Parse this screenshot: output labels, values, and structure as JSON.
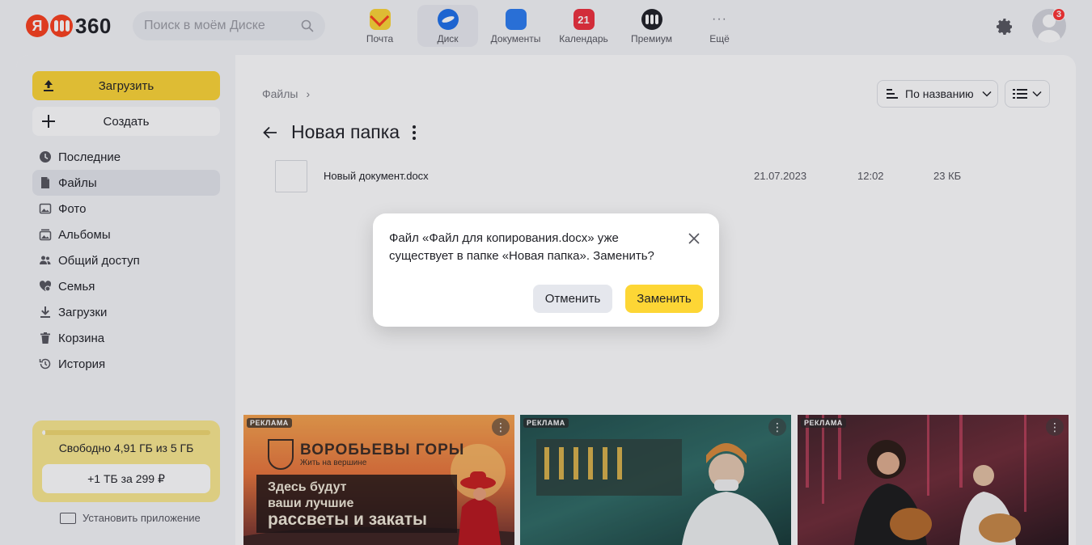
{
  "header": {
    "logo_text": "360",
    "search_placeholder": "Поиск в моём Диске",
    "apps": [
      {
        "label": "Почта",
        "icon": "mail-icon"
      },
      {
        "label": "Диск",
        "icon": "disk-icon",
        "active": true
      },
      {
        "label": "Документы",
        "icon": "documents-icon"
      },
      {
        "label": "Календарь",
        "icon": "calendar-icon",
        "badge": "21"
      },
      {
        "label": "Премиум",
        "icon": "premium-icon"
      },
      {
        "label": "Ещё",
        "icon": "more-icon"
      }
    ],
    "notifications_count": "3"
  },
  "sidebar": {
    "upload_label": "Загрузить",
    "create_label": "Создать",
    "items": [
      {
        "label": "Последние",
        "icon": "clock-icon"
      },
      {
        "label": "Файлы",
        "icon": "file-icon",
        "active": true
      },
      {
        "label": "Фото",
        "icon": "photo-icon"
      },
      {
        "label": "Альбомы",
        "icon": "album-icon"
      },
      {
        "label": "Общий доступ",
        "icon": "shared-icon"
      },
      {
        "label": "Семья",
        "icon": "family-icon"
      },
      {
        "label": "Загрузки",
        "icon": "download-icon"
      },
      {
        "label": "Корзина",
        "icon": "trash-icon"
      },
      {
        "label": "История",
        "icon": "history-icon"
      }
    ],
    "storage": {
      "used_fraction": 0.02,
      "free_text": "Свободно 4,91 ГБ из 5 ГБ",
      "buy_label": "+1 ТБ за 299 ₽"
    },
    "install_label": "Установить приложение"
  },
  "main": {
    "breadcrumb": "Файлы",
    "breadcrumb_sep": "›",
    "sort_label": "По названию",
    "folder_title": "Новая папка",
    "files": [
      {
        "name": "Новый документ.docx",
        "date": "21.07.2023",
        "time": "12:02",
        "size": "23 КБ"
      }
    ]
  },
  "ads": [
    {
      "tag": "РЕКЛАМА",
      "brand": "ВОРОБЬЕВЫ ГОРЫ",
      "brand_sub": "Жить на вершине",
      "line1": "Здесь будут",
      "line2": "ваши лучшие",
      "line3": "рассветы и закаты"
    },
    {
      "tag": "РЕКЛАМА"
    },
    {
      "tag": "РЕКЛАМА"
    }
  ],
  "dialog": {
    "message": "Файл «Файл для копирования.docx» уже существует в папке «Новая папка». Заменить?",
    "cancel_label": "Отменить",
    "replace_label": "Заменить"
  },
  "colors": {
    "accent_yellow": "#fdd635",
    "brand_red": "#fc3f1d",
    "badge_red": "#ff3333"
  }
}
